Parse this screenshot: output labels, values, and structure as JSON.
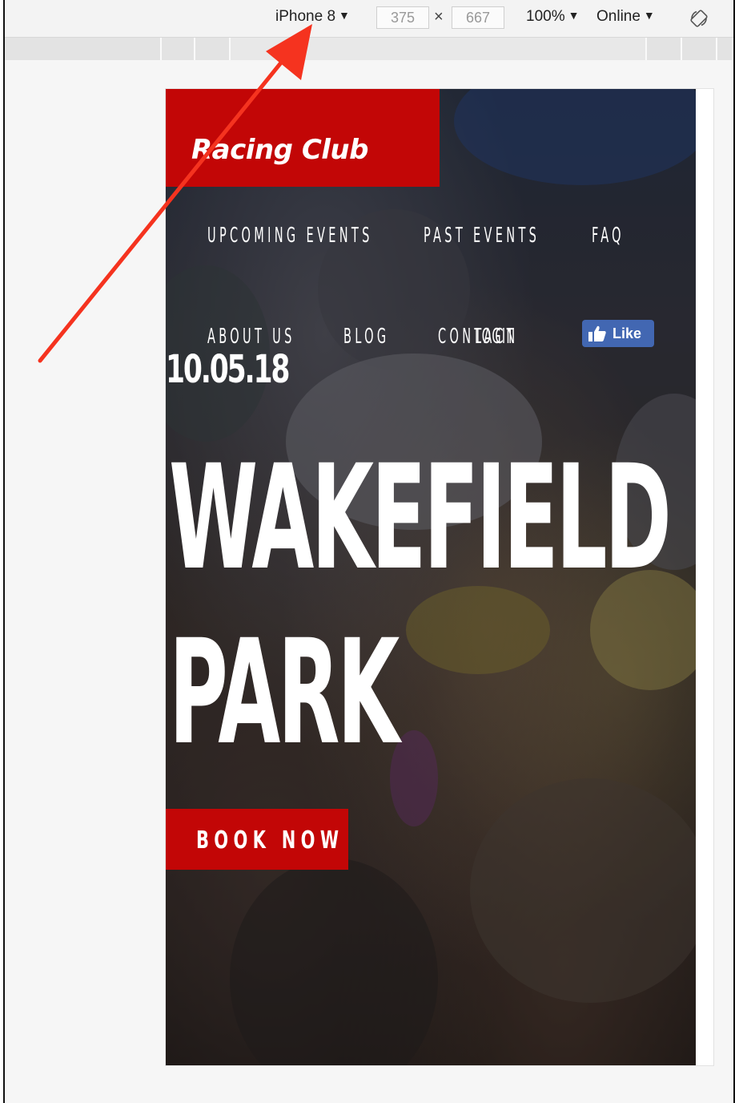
{
  "devtools_toolbar": {
    "device": "iPhone 8",
    "width": "375",
    "times_sign": "×",
    "height": "667",
    "zoom": "100%",
    "network": "Online",
    "caret": "▼",
    "rotate_icon": "rotate-device-icon"
  },
  "site": {
    "brand": "Racing Club",
    "nav": {
      "upcoming_events": "UPCOMING EVENTS",
      "past_events": "PAST EVENTS",
      "faq": "FAQ",
      "about_us": "ABOUT US",
      "blog": "BLOG",
      "contact": "CONTACT",
      "login": "LOGIN"
    },
    "fb_like": "Like",
    "date": "10.05.18",
    "headline_line1": "WAKEFIELD",
    "headline_line2": "PARK",
    "cta": "BOOK NOW"
  },
  "colors": {
    "brand_red": "#c20606",
    "fb_blue": "#4267b2",
    "annotation_arrow": "#f5331f"
  }
}
